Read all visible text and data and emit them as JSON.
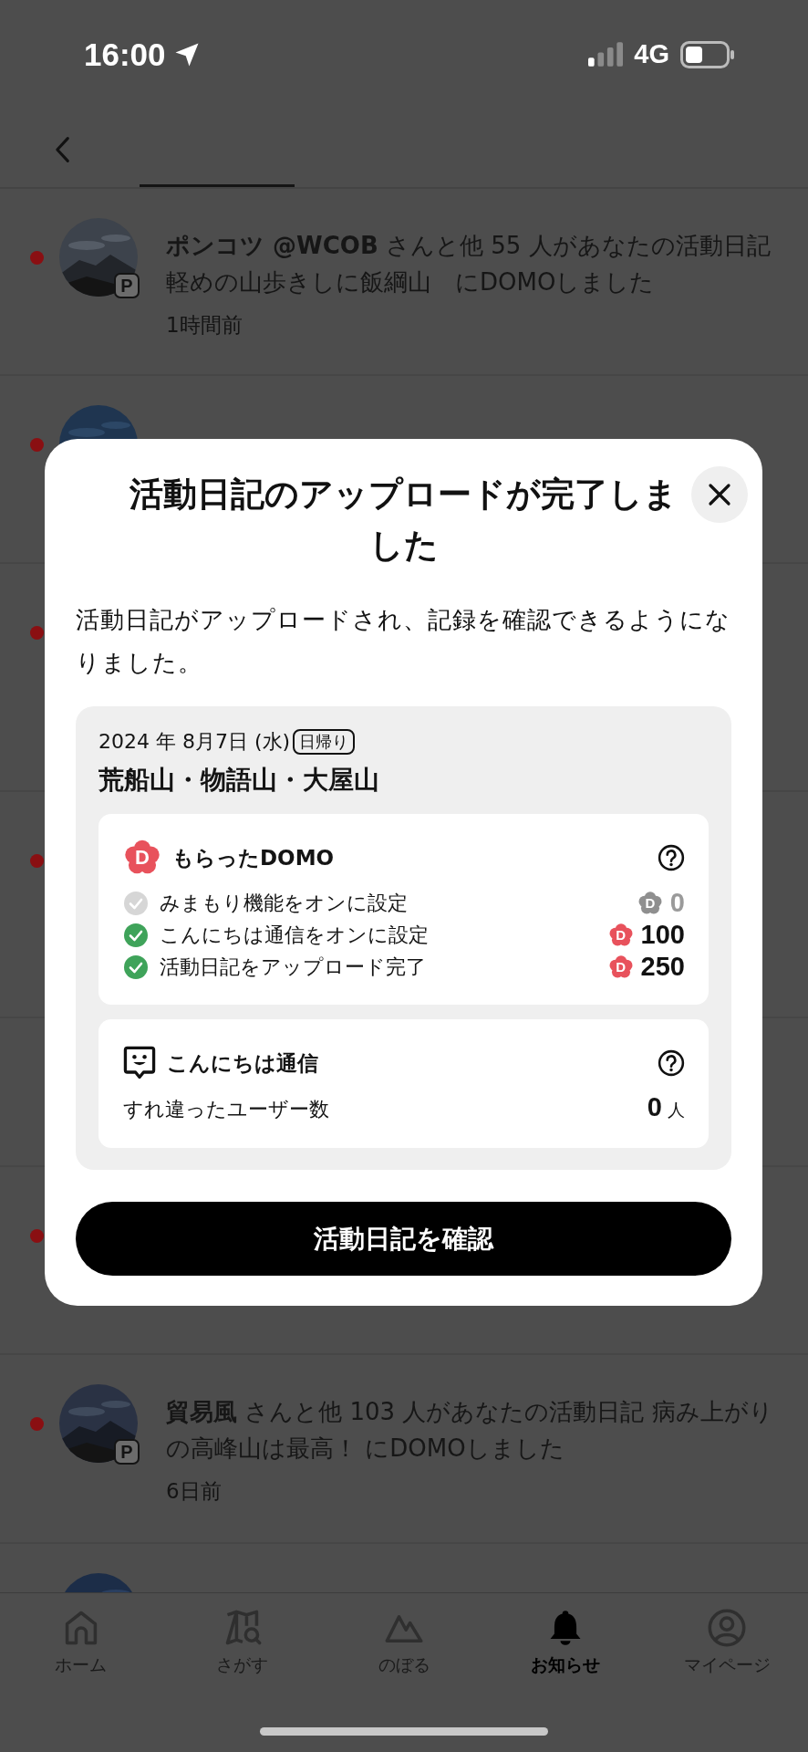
{
  "status_bar": {
    "time": "16:00",
    "network": "4G"
  },
  "notifications": [
    {
      "unread": true,
      "kind": "picture",
      "badge": "P",
      "text": "**ポンコツ @WCOB** さんと他 55 人があなたの活動日記軽めの山歩きしに飯綱山　にDOMOしました",
      "time": "1時間前"
    },
    {
      "unread": true,
      "kind": "picture"
    },
    {
      "unread": true
    },
    {
      "unread": true
    },
    {
      "unread": false
    },
    {
      "unread": true
    },
    {
      "unread": true,
      "kind": "picture",
      "badge": "P",
      "text": "**貿易風** さんと他 103 人があなたの活動日記 病み上がりの高峰山は最高！ にDOMOしました",
      "time": "6日前"
    },
    {
      "kind": "picture"
    }
  ],
  "modal": {
    "title": "活動日記のアップロードが完了しました",
    "message": "活動日記がアップロードされ、記録を確認できるようになりました。",
    "date": "2024 年 8月7日 (水)",
    "trip_type": "日帰り",
    "mountains": "荒船山・物語山・大屋山",
    "domo": {
      "mark": "D",
      "title": "もらったDOMO",
      "items": [
        {
          "label": "みまもり機能をオンに設定",
          "checked": false,
          "mark": "D",
          "points": "0"
        },
        {
          "label": "こんにちは通信をオンに設定",
          "checked": true,
          "mark": "D",
          "points": "100"
        },
        {
          "label": "活動日記をアップロード完了",
          "checked": true,
          "mark": "D",
          "points": "250"
        }
      ]
    },
    "greeting": {
      "title": "こんにちは通信",
      "label": "すれ違ったユーザー数",
      "count": "0",
      "unit": "人"
    },
    "button": "活動日記を確認"
  },
  "tab_bar": [
    {
      "label": "ホーム",
      "selected": false
    },
    {
      "label": "さがす",
      "selected": false
    },
    {
      "label": "のぼる",
      "selected": false
    },
    {
      "label": "お知らせ",
      "selected": true
    },
    {
      "label": "マイページ",
      "selected": false
    }
  ]
}
